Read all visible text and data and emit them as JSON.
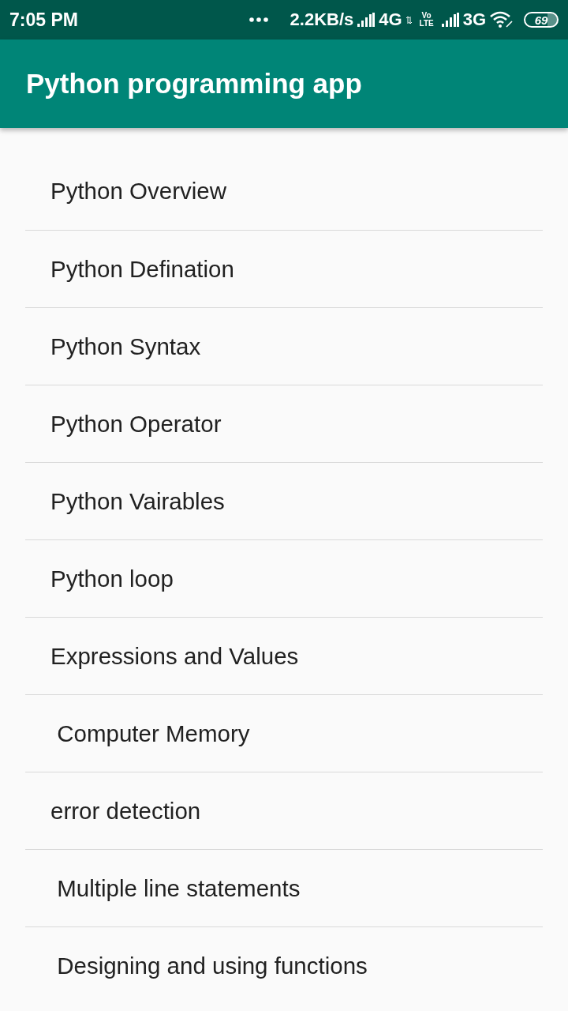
{
  "status_bar": {
    "time": "7:05 PM",
    "network_speed": "2.2KB/s",
    "sim_1": "4G",
    "volte": "Vo LTE",
    "sim_2": "3G",
    "battery": "69"
  },
  "app_bar": {
    "title": "Python programming app"
  },
  "topics": [
    {
      "label": "Python Overview"
    },
    {
      "label": "Python Defination"
    },
    {
      "label": "Python Syntax"
    },
    {
      "label": "Python Operator"
    },
    {
      "label": "Python Vairables"
    },
    {
      "label": "Python loop"
    },
    {
      "label": "Expressions and Values"
    },
    {
      "label": " Computer Memory"
    },
    {
      "label": "error detection"
    },
    {
      "label": " Multiple line statements"
    },
    {
      "label": " Designing and using functions"
    }
  ]
}
